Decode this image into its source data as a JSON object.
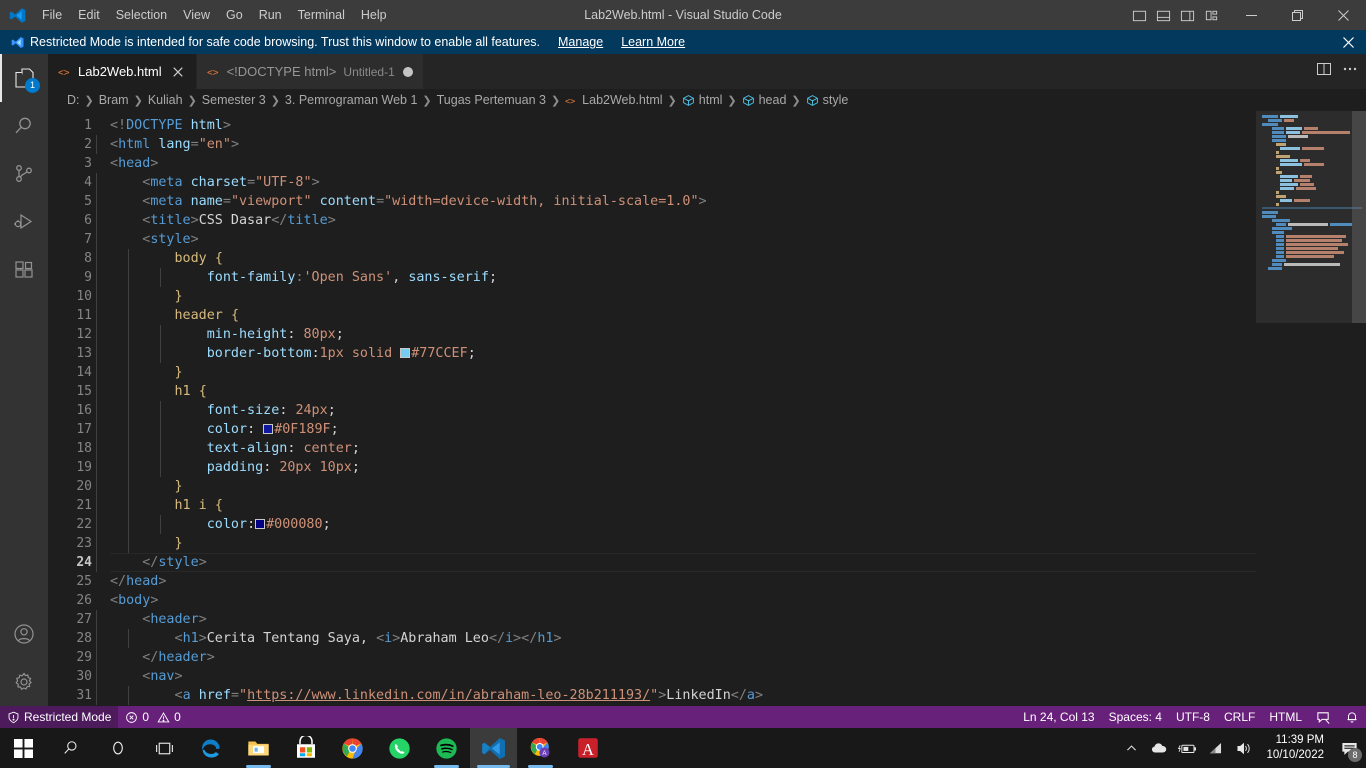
{
  "window": {
    "title": "Lab2Web.html - Visual Studio Code",
    "menu": [
      "File",
      "Edit",
      "Selection",
      "View",
      "Go",
      "Run",
      "Terminal",
      "Help"
    ],
    "layout_icons": [
      "toggle-primary-sidebar-icon",
      "toggle-panel-icon",
      "toggle-secondary-sidebar-icon",
      "customize-layout-icon"
    ],
    "controls": {
      "minimize": "─",
      "restore": "❐",
      "close": "✕"
    }
  },
  "banner": {
    "text": "Restricted Mode is intended for safe code browsing. Trust this window to enable all features.",
    "manage": "Manage",
    "learn_more": "Learn More",
    "close": "✕",
    "background": "#04395e"
  },
  "activitybar": {
    "items": [
      {
        "name": "explorer",
        "badge": "1"
      },
      {
        "name": "search",
        "badge": ""
      },
      {
        "name": "source-control",
        "badge": ""
      },
      {
        "name": "run-and-debug",
        "badge": ""
      },
      {
        "name": "extensions",
        "badge": ""
      }
    ],
    "bottom": [
      {
        "name": "accounts"
      },
      {
        "name": "manage-settings"
      }
    ]
  },
  "tabs": [
    {
      "label": "Lab2Web.html",
      "description": "",
      "active": true,
      "dirty": false,
      "icon": "html-file-icon"
    },
    {
      "label": "<!DOCTYPE html>",
      "description": "Untitled-1",
      "active": false,
      "dirty": true,
      "icon": "html-file-icon"
    }
  ],
  "tab_actions": {
    "split_editor": "split-editor-icon",
    "more_actions": "more-actions-icon"
  },
  "breadcrumbs": [
    {
      "label": "D:",
      "icon": ""
    },
    {
      "label": "Bram",
      "icon": ""
    },
    {
      "label": "Kuliah",
      "icon": ""
    },
    {
      "label": "Semester 3",
      "icon": ""
    },
    {
      "label": "3. Pemrograman Web 1",
      "icon": ""
    },
    {
      "label": "Tugas Pertemuan 3",
      "icon": ""
    },
    {
      "label": "Lab2Web.html",
      "icon": "html-file-icon"
    },
    {
      "label": "html",
      "icon": "symbol-cube-icon"
    },
    {
      "label": "head",
      "icon": "symbol-cube-icon"
    },
    {
      "label": "style",
      "icon": "symbol-cube-icon"
    }
  ],
  "editor": {
    "language": "HTML",
    "current_line": 24,
    "first_line": 1,
    "last_visible_line": 31,
    "lines": [
      {
        "n": 1,
        "text": "<!DOCTYPE html>"
      },
      {
        "n": 2,
        "text": "<html lang=\"en\">"
      },
      {
        "n": 3,
        "text": "<head>"
      },
      {
        "n": 4,
        "text": "    <meta charset=\"UTF-8\">"
      },
      {
        "n": 5,
        "text": "    <meta name=\"viewport\" content=\"width=device-width, initial-scale=1.0\">"
      },
      {
        "n": 6,
        "text": "    <title>CSS Dasar</title>"
      },
      {
        "n": 7,
        "text": "    <style>"
      },
      {
        "n": 8,
        "text": "        body {"
      },
      {
        "n": 9,
        "text": "            font-family:'Open Sans', sans-serif;"
      },
      {
        "n": 10,
        "text": "        }"
      },
      {
        "n": 11,
        "text": "        header {"
      },
      {
        "n": 12,
        "text": "            min-height: 80px;"
      },
      {
        "n": 13,
        "text": "            border-bottom:1px solid #77CCEF;"
      },
      {
        "n": 14,
        "text": "        }"
      },
      {
        "n": 15,
        "text": "        h1 {"
      },
      {
        "n": 16,
        "text": "            font-size: 24px;"
      },
      {
        "n": 17,
        "text": "            color: #0F189F;"
      },
      {
        "n": 18,
        "text": "            text-align: center;"
      },
      {
        "n": 19,
        "text": "            padding: 20px 10px;"
      },
      {
        "n": 20,
        "text": "        }"
      },
      {
        "n": 21,
        "text": "        h1 i {"
      },
      {
        "n": 22,
        "text": "            color:#000080;"
      },
      {
        "n": 23,
        "text": "        }"
      },
      {
        "n": 24,
        "text": "    </style>"
      },
      {
        "n": 25,
        "text": "</head>"
      },
      {
        "n": 26,
        "text": "<body>"
      },
      {
        "n": 27,
        "text": "    <header>"
      },
      {
        "n": 28,
        "text": "        <h1>Cerita Tentang Saya, <i>Abraham Leo</i></h1>"
      },
      {
        "n": 29,
        "text": "    </header>"
      },
      {
        "n": 30,
        "text": "    <nav>"
      },
      {
        "n": 31,
        "text": "        <a href=\"https://www.linkedin.com/in/abraham-leo-28b211193/\">LinkedIn</a>"
      }
    ],
    "color_swatches": [
      {
        "line": 13,
        "value": "#77CCEF"
      },
      {
        "line": 17,
        "value": "#0F189F"
      },
      {
        "line": 22,
        "value": "#000080"
      }
    ],
    "link_url": "https://www.linkedin.com/in/abraham-leo-28b211193/"
  },
  "statusbar": {
    "background": "#68217a",
    "restricted_mode": "Restricted Mode",
    "errors": "0",
    "warnings": "0",
    "position": "Ln 24, Col 13",
    "indentation": "Spaces: 4",
    "encoding": "UTF-8",
    "eol": "CRLF",
    "language": "HTML",
    "feedback": "feedback-smiley-icon",
    "bell": "notifications-bell-icon"
  },
  "taskbar": {
    "items": [
      {
        "name": "start-button",
        "label": "Start",
        "active": false,
        "running": false
      },
      {
        "name": "search-button",
        "label": "Search",
        "active": false,
        "running": false
      },
      {
        "name": "cortana-button",
        "label": "Cortana",
        "active": false,
        "running": false
      },
      {
        "name": "task-view-button",
        "label": "Task View",
        "active": false,
        "running": false
      },
      {
        "name": "microsoft-edge",
        "label": "Microsoft Edge",
        "active": false,
        "running": false
      },
      {
        "name": "file-explorer",
        "label": "File Explorer",
        "active": false,
        "running": true
      },
      {
        "name": "microsoft-store",
        "label": "Microsoft Store",
        "active": false,
        "running": false
      },
      {
        "name": "google-chrome",
        "label": "Google Chrome",
        "active": false,
        "running": false
      },
      {
        "name": "whatsapp",
        "label": "WhatsApp",
        "active": false,
        "running": false
      },
      {
        "name": "spotify",
        "label": "Spotify",
        "active": false,
        "running": true
      },
      {
        "name": "visual-studio-code",
        "label": "Visual Studio Code",
        "active": true,
        "running": true
      },
      {
        "name": "chrome-profile",
        "label": "Chrome",
        "active": false,
        "running": true
      },
      {
        "name": "adobe-acrobat",
        "label": "Adobe Acrobat Reader",
        "active": false,
        "running": false
      }
    ],
    "tray": [
      "show-hidden-icons-chevron",
      "onedrive-icon",
      "battery-charging-icon",
      "wifi-icon",
      "volume-icon"
    ],
    "time": "11:39 PM",
    "date": "10/10/2022",
    "notification_count": "8"
  }
}
